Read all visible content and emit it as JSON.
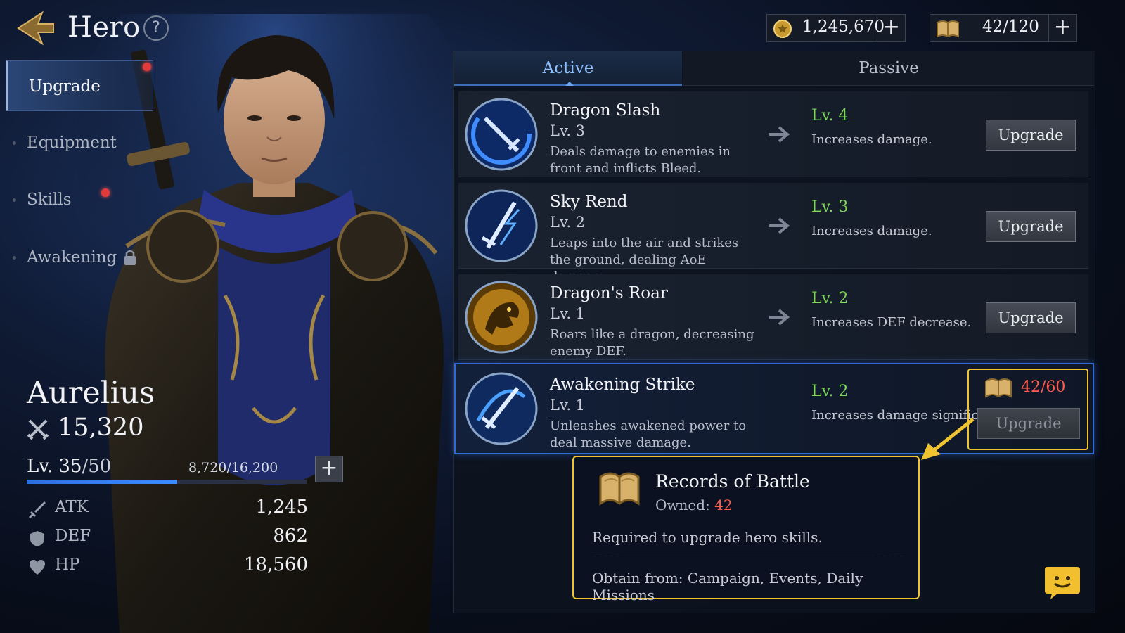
{
  "header": {
    "title": "Hero",
    "help_label": "?"
  },
  "currencies": [
    {
      "icon": "gold-coin-icon",
      "value": "1,245,670",
      "add_label": "+"
    },
    {
      "icon": "book-icon",
      "value": "42/120",
      "add_label": "+"
    }
  ],
  "sidebar": {
    "items": [
      {
        "label": "Upgrade",
        "active": true,
        "red_dot": true
      },
      {
        "label": "Equipment",
        "active": false,
        "red_dot": false
      },
      {
        "label": "Skills",
        "active": false,
        "red_dot": true
      },
      {
        "label": "Awakening",
        "active": false,
        "locked": true
      }
    ]
  },
  "hero": {
    "name": "Aurelius",
    "power": "15,320",
    "level": "Lv. 35",
    "level_max": "/50",
    "exp_text": "8,720/16,200",
    "exp_fraction": 0.538,
    "exp_add_label": "+",
    "stats": [
      {
        "icon": "sword-icon",
        "label": "ATK",
        "value": "1,245"
      },
      {
        "icon": "shield-icon",
        "label": "DEF",
        "value": "862"
      },
      {
        "icon": "heart-icon",
        "label": "HP",
        "value": "18,560"
      }
    ]
  },
  "tabs": {
    "active": "Active",
    "passive": "Passive"
  },
  "skills": [
    {
      "name": "Dragon Slash",
      "level": "Lv. 3",
      "desc": "Deals damage to enemies in front and inflicts Bleed.",
      "next_level": "Lv. 4",
      "next_desc": "Increases damage.",
      "button": "Upgrade",
      "icon": "blue-slash-icon"
    },
    {
      "name": "Sky Rend",
      "level": "Lv. 2",
      "desc": "Leaps into the air and strikes the ground, dealing AoE damage.",
      "next_level": "Lv. 3",
      "next_desc": "Increases damage.",
      "button": "Upgrade",
      "icon": "lightning-sword-icon"
    },
    {
      "name": "Dragon's Roar",
      "level": "Lv. 1",
      "desc": "Roars like a dragon, decreasing enemy DEF.",
      "next_level": "Lv. 2",
      "next_desc": "Increases DEF decrease.",
      "button": "Upgrade",
      "icon": "dragon-head-icon"
    },
    {
      "name": "Awakening Strike",
      "level": "Lv. 1",
      "desc": "Unleashes awakened power to deal massive damage.",
      "next_level": "Lv. 2",
      "next_desc": "Increases damage significantly.",
      "button": "Upgrade",
      "icon": "awakening-sword-icon",
      "cost": "42/60"
    }
  ],
  "tooltip": {
    "title": "Records of Battle",
    "owned_label": "Owned:",
    "owned_value": "42",
    "desc": "Required to upgrade hero skills.",
    "obtain": "Obtain from: Campaign, Events, Daily Missions"
  },
  "colors": {
    "accent_blue": "#2f6ad6",
    "next_level_green": "#7ed957",
    "highlight_gold": "#f0c330",
    "insufficient_red": "#ff5a4a"
  }
}
